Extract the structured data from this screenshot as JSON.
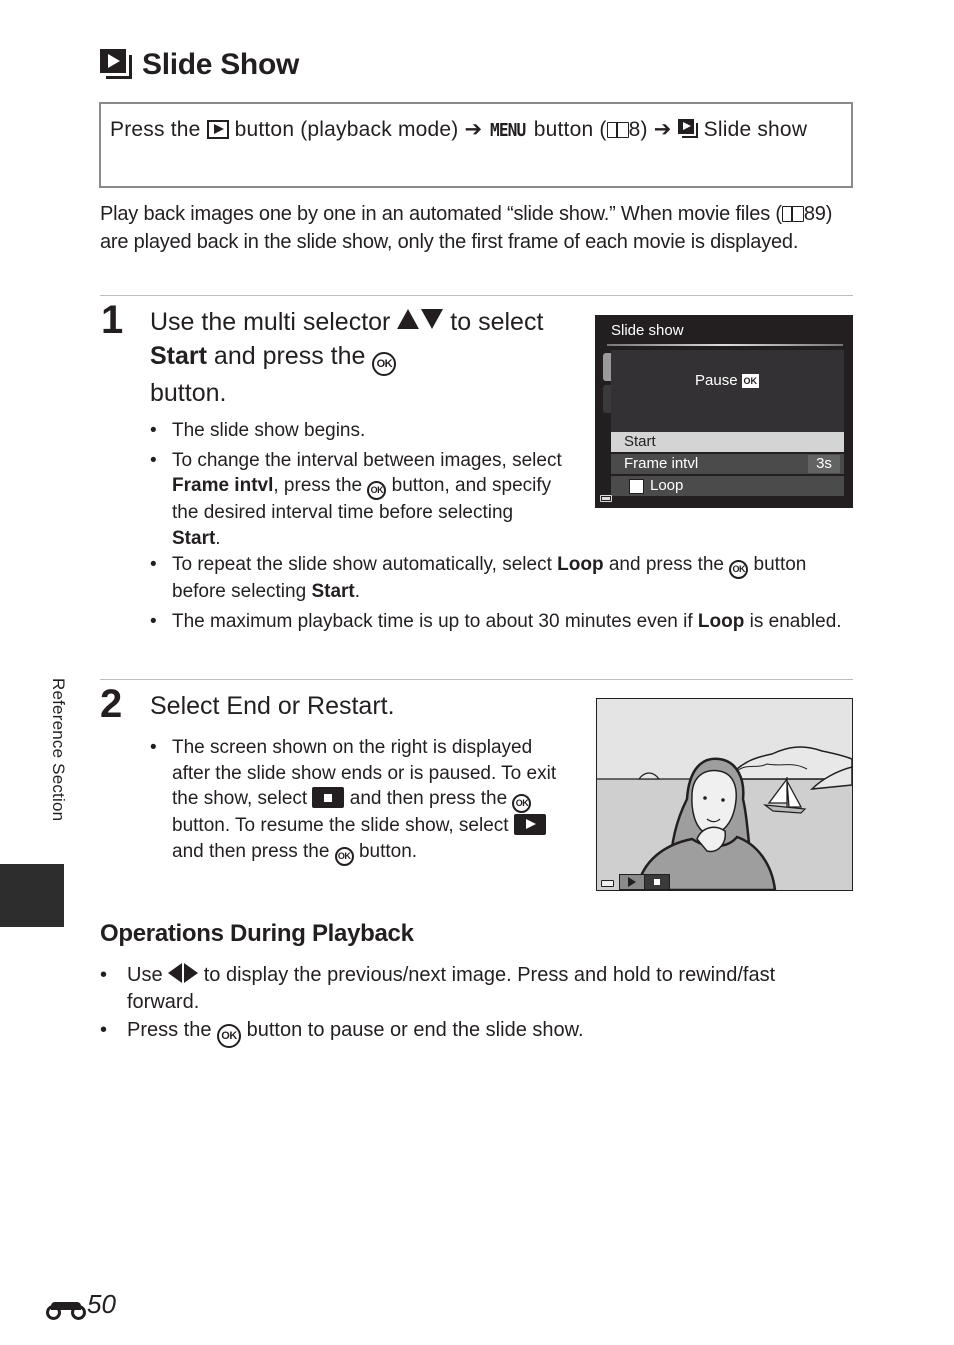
{
  "title": "Slide Show",
  "title_icon": "slide-show-icon",
  "path": {
    "press_the": "Press the",
    "play_icon": "playback-button-icon",
    "after_play": "button (playback mode)",
    "arrow": "➔",
    "menu_label": "MENU",
    "menu_after": "button (",
    "menu_ref": "8",
    "menu_close": ")",
    "end_label": "Slide show"
  },
  "intro": {
    "line1": "Play back images one by one in an automated “slide show.” When movie files (",
    "ref": "89",
    "line2": ") are played back in the slide show, only the first frame of each movie is displayed."
  },
  "step1": {
    "number": "1",
    "title_a": "Use the multi selector",
    "title_b": "to select",
    "title_bold": "Start",
    "title_c": "and press the",
    "title_d": "button.",
    "bullets": [
      {
        "text": "The slide show begins."
      },
      {
        "a": "To change the interval between images, select",
        "bold": "Frame intvl",
        "b": ", press the",
        "c": "button, and specify the desired interval time before selecting",
        "bold2": "Start",
        "d": "."
      },
      {
        "a": "To repeat the slide show automatically, select",
        "bold": "Loop",
        "b": "and press the",
        "c": "button before selecting",
        "bold2": "Start",
        "d": "."
      },
      {
        "a": "The maximum playback time is up to about 30 minutes even if",
        "bold": "Loop",
        "b": "is enabled."
      }
    ]
  },
  "camera_menu": {
    "header": "Slide show",
    "pause_label": "Pause",
    "ok_badge": "OK",
    "items": [
      {
        "label": "Start",
        "selected": true
      },
      {
        "label": "Frame intvl",
        "value": "3s"
      },
      {
        "label": "Loop",
        "checked": false
      }
    ]
  },
  "step2": {
    "number": "2",
    "title": "Select End or Restart.",
    "bullet": {
      "a": "The screen shown on the right is displayed after the slide show ends or is paused. To exit the show, select",
      "b": "and then press the",
      "c": "button. To resume the slide show, select",
      "d": "and then press the",
      "e": "button."
    }
  },
  "camera_playback": {
    "controls": [
      "play",
      "stop"
    ],
    "image_description": "woman portrait with sailboat and hills"
  },
  "operations": {
    "title": "Operations During Playback",
    "bullet1_a": "Use",
    "bullet1_b": "to display the previous/next image. Press and hold to rewind/fast forward.",
    "bullet2_a": "Press the",
    "bullet2_b": "button to pause or end the slide show."
  },
  "ok_label": "OK",
  "side_tab": "Reference Section",
  "page_number": "50",
  "page_icon": "binoculars-icon"
}
